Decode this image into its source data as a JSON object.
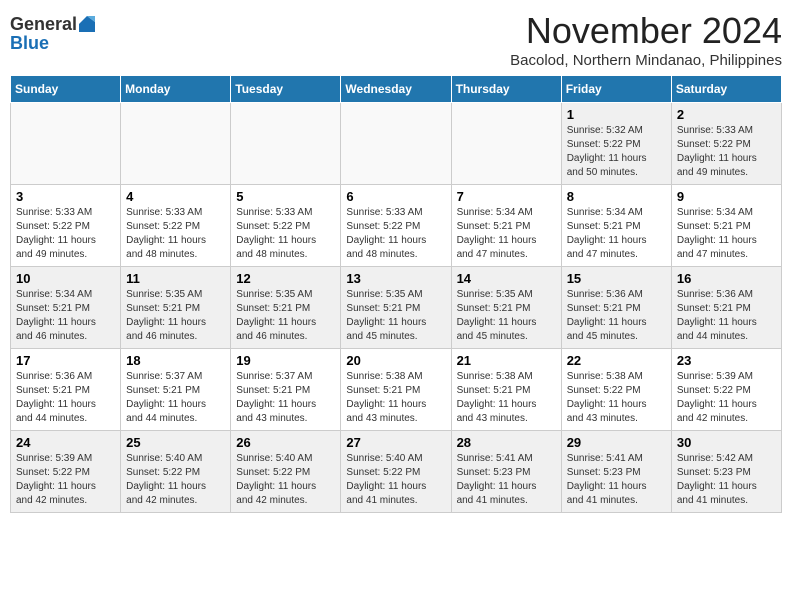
{
  "logo": {
    "general": "General",
    "blue": "Blue"
  },
  "title": "November 2024",
  "subtitle": "Bacolod, Northern Mindanao, Philippines",
  "days_of_week": [
    "Sunday",
    "Monday",
    "Tuesday",
    "Wednesday",
    "Thursday",
    "Friday",
    "Saturday"
  ],
  "weeks": [
    [
      {
        "day": "",
        "info": ""
      },
      {
        "day": "",
        "info": ""
      },
      {
        "day": "",
        "info": ""
      },
      {
        "day": "",
        "info": ""
      },
      {
        "day": "",
        "info": ""
      },
      {
        "day": "1",
        "info": "Sunrise: 5:32 AM\nSunset: 5:22 PM\nDaylight: 11 hours and 50 minutes."
      },
      {
        "day": "2",
        "info": "Sunrise: 5:33 AM\nSunset: 5:22 PM\nDaylight: 11 hours and 49 minutes."
      }
    ],
    [
      {
        "day": "3",
        "info": "Sunrise: 5:33 AM\nSunset: 5:22 PM\nDaylight: 11 hours and 49 minutes."
      },
      {
        "day": "4",
        "info": "Sunrise: 5:33 AM\nSunset: 5:22 PM\nDaylight: 11 hours and 48 minutes."
      },
      {
        "day": "5",
        "info": "Sunrise: 5:33 AM\nSunset: 5:22 PM\nDaylight: 11 hours and 48 minutes."
      },
      {
        "day": "6",
        "info": "Sunrise: 5:33 AM\nSunset: 5:22 PM\nDaylight: 11 hours and 48 minutes."
      },
      {
        "day": "7",
        "info": "Sunrise: 5:34 AM\nSunset: 5:21 PM\nDaylight: 11 hours and 47 minutes."
      },
      {
        "day": "8",
        "info": "Sunrise: 5:34 AM\nSunset: 5:21 PM\nDaylight: 11 hours and 47 minutes."
      },
      {
        "day": "9",
        "info": "Sunrise: 5:34 AM\nSunset: 5:21 PM\nDaylight: 11 hours and 47 minutes."
      }
    ],
    [
      {
        "day": "10",
        "info": "Sunrise: 5:34 AM\nSunset: 5:21 PM\nDaylight: 11 hours and 46 minutes."
      },
      {
        "day": "11",
        "info": "Sunrise: 5:35 AM\nSunset: 5:21 PM\nDaylight: 11 hours and 46 minutes."
      },
      {
        "day": "12",
        "info": "Sunrise: 5:35 AM\nSunset: 5:21 PM\nDaylight: 11 hours and 46 minutes."
      },
      {
        "day": "13",
        "info": "Sunrise: 5:35 AM\nSunset: 5:21 PM\nDaylight: 11 hours and 45 minutes."
      },
      {
        "day": "14",
        "info": "Sunrise: 5:35 AM\nSunset: 5:21 PM\nDaylight: 11 hours and 45 minutes."
      },
      {
        "day": "15",
        "info": "Sunrise: 5:36 AM\nSunset: 5:21 PM\nDaylight: 11 hours and 45 minutes."
      },
      {
        "day": "16",
        "info": "Sunrise: 5:36 AM\nSunset: 5:21 PM\nDaylight: 11 hours and 44 minutes."
      }
    ],
    [
      {
        "day": "17",
        "info": "Sunrise: 5:36 AM\nSunset: 5:21 PM\nDaylight: 11 hours and 44 minutes."
      },
      {
        "day": "18",
        "info": "Sunrise: 5:37 AM\nSunset: 5:21 PM\nDaylight: 11 hours and 44 minutes."
      },
      {
        "day": "19",
        "info": "Sunrise: 5:37 AM\nSunset: 5:21 PM\nDaylight: 11 hours and 43 minutes."
      },
      {
        "day": "20",
        "info": "Sunrise: 5:38 AM\nSunset: 5:21 PM\nDaylight: 11 hours and 43 minutes."
      },
      {
        "day": "21",
        "info": "Sunrise: 5:38 AM\nSunset: 5:21 PM\nDaylight: 11 hours and 43 minutes."
      },
      {
        "day": "22",
        "info": "Sunrise: 5:38 AM\nSunset: 5:22 PM\nDaylight: 11 hours and 43 minutes."
      },
      {
        "day": "23",
        "info": "Sunrise: 5:39 AM\nSunset: 5:22 PM\nDaylight: 11 hours and 42 minutes."
      }
    ],
    [
      {
        "day": "24",
        "info": "Sunrise: 5:39 AM\nSunset: 5:22 PM\nDaylight: 11 hours and 42 minutes."
      },
      {
        "day": "25",
        "info": "Sunrise: 5:40 AM\nSunset: 5:22 PM\nDaylight: 11 hours and 42 minutes."
      },
      {
        "day": "26",
        "info": "Sunrise: 5:40 AM\nSunset: 5:22 PM\nDaylight: 11 hours and 42 minutes."
      },
      {
        "day": "27",
        "info": "Sunrise: 5:40 AM\nSunset: 5:22 PM\nDaylight: 11 hours and 41 minutes."
      },
      {
        "day": "28",
        "info": "Sunrise: 5:41 AM\nSunset: 5:23 PM\nDaylight: 11 hours and 41 minutes."
      },
      {
        "day": "29",
        "info": "Sunrise: 5:41 AM\nSunset: 5:23 PM\nDaylight: 11 hours and 41 minutes."
      },
      {
        "day": "30",
        "info": "Sunrise: 5:42 AM\nSunset: 5:23 PM\nDaylight: 11 hours and 41 minutes."
      }
    ]
  ]
}
